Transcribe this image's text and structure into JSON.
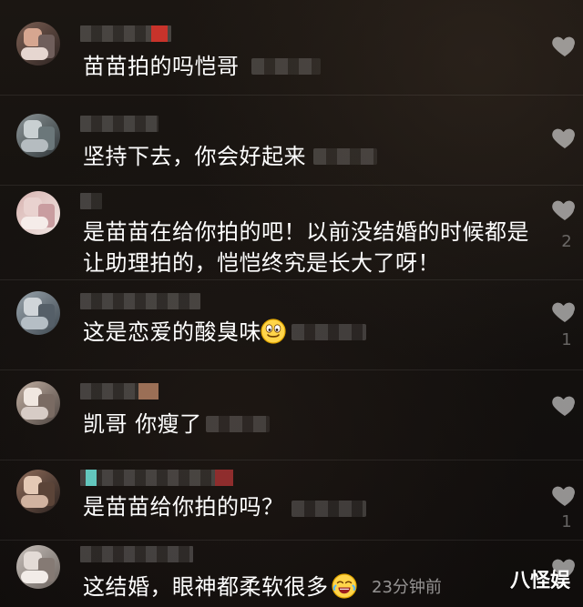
{
  "comments": [
    {
      "text": "苗苗拍的吗恺哥",
      "likes": ""
    },
    {
      "text": "坚持下去，你会好起来",
      "likes": ""
    },
    {
      "text": "是苗苗在给你拍的吧！以前没结婚的时候都是\n让助理拍的，恺恺终究是长大了呀！",
      "likes": "2"
    },
    {
      "text": "这是恋爱的酸臭味",
      "likes": "1",
      "emoji": "smiling-face-icon"
    },
    {
      "text": "凯哥 你瘦了",
      "likes": ""
    },
    {
      "text": "是苗苗给你拍的吗？",
      "likes": "1"
    },
    {
      "text": "这结婚，眼神都柔软很多",
      "likes": "",
      "emoji": "laughing-face-icon",
      "time": "23分钟前"
    }
  ],
  "watermark": "八怪娱"
}
